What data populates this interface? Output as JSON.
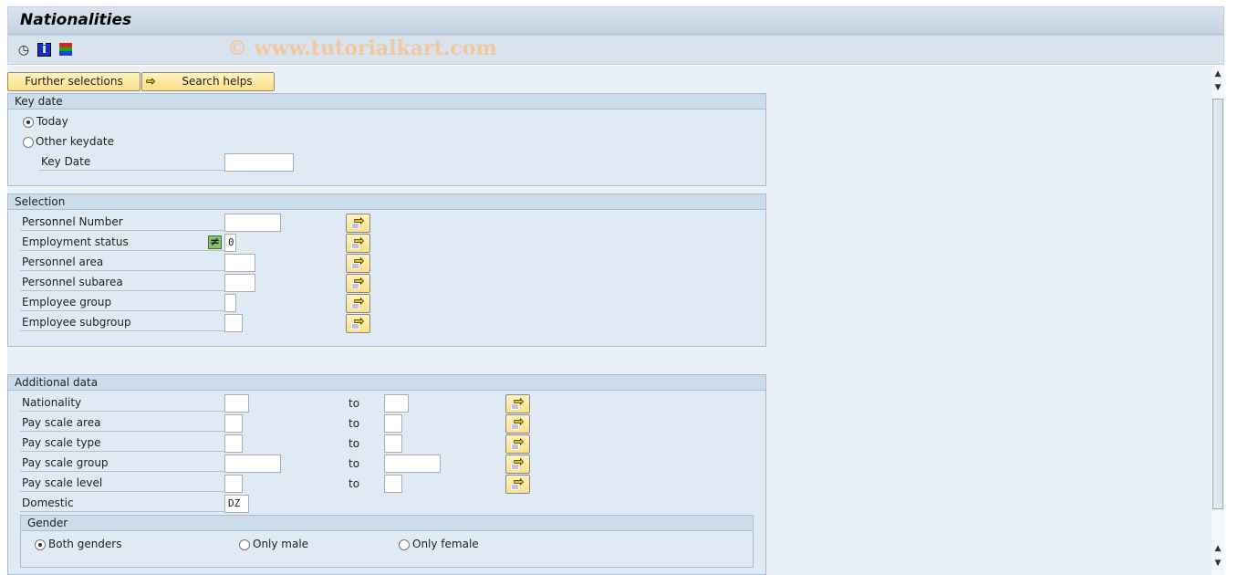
{
  "window": {
    "title": "Nationalities"
  },
  "toolbar": {
    "icons": [
      "execute-clock-icon",
      "info-icon",
      "selection-options-icon"
    ],
    "watermark": "© www.tutorialkart.com"
  },
  "buttons": {
    "further_selections": "Further selections",
    "search_helps": "Search helps"
  },
  "key_date": {
    "header": "Key date",
    "today": "Today",
    "other": "Other keydate",
    "key_date_label": "Key Date",
    "key_date_value": "",
    "selected": "Today"
  },
  "selection": {
    "header": "Selection",
    "rows": [
      {
        "label": "Personnel Number",
        "value": ""
      },
      {
        "label": "Employment status",
        "value": "0",
        "option_icon": "not-equal-icon"
      },
      {
        "label": "Personnel area",
        "value": ""
      },
      {
        "label": "Personnel subarea",
        "value": ""
      },
      {
        "label": "Employee group",
        "value": ""
      },
      {
        "label": "Employee subgroup",
        "value": ""
      }
    ]
  },
  "additional": {
    "header": "Additional data",
    "to_label": "to",
    "rows": [
      {
        "label": "Nationality",
        "from": "",
        "to": ""
      },
      {
        "label": "Pay scale area",
        "from": "",
        "to": ""
      },
      {
        "label": "Pay scale type",
        "from": "",
        "to": ""
      },
      {
        "label": "Pay scale group",
        "from": "",
        "to": ""
      },
      {
        "label": "Pay scale level",
        "from": "",
        "to": ""
      }
    ],
    "domestic_label": "Domestic",
    "domestic_value": "DZ"
  },
  "gender": {
    "header": "Gender",
    "options": [
      "Both genders",
      "Only male",
      "Only female"
    ],
    "selected": "Both genders"
  },
  "colors": {
    "button_yellow": "#fbe08a",
    "frame_bg": "#dfeaf4",
    "title_bg": "#c4d3e3"
  }
}
